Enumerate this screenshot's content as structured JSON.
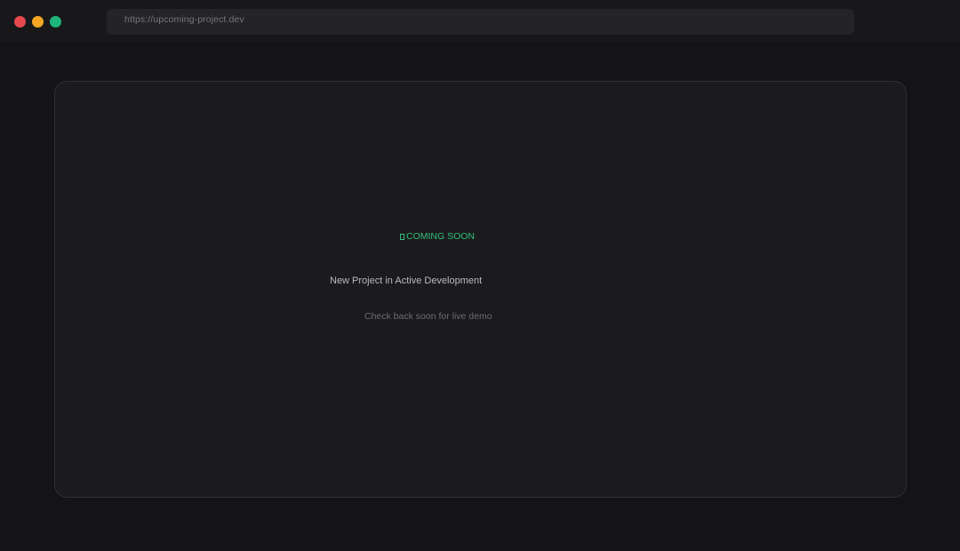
{
  "browser": {
    "url": "https://upcoming-project.dev",
    "colors": {
      "close": "#e5484d",
      "minimize": "#f5a623",
      "maximize": "#1fb57a"
    }
  },
  "card": {
    "badge": "COMING SOON",
    "badge_icon": "square-dot-icon",
    "badge_color": "#2fbf7f",
    "heading": "New Project in Active Development",
    "subtext": "Check back soon for live demo"
  }
}
